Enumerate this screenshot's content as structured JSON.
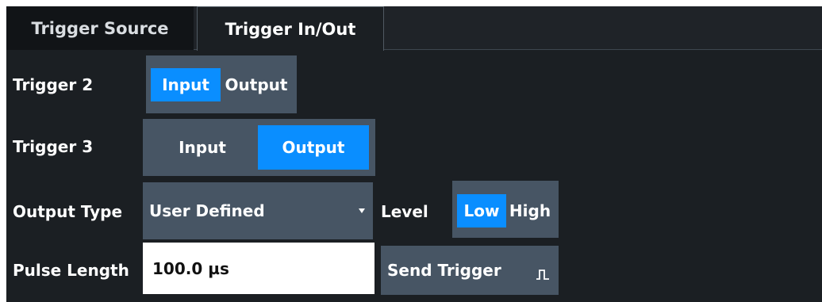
{
  "tabs": [
    {
      "label": "Trigger Source",
      "active": false
    },
    {
      "label": "Trigger In/Out",
      "active": true
    }
  ],
  "trigger2": {
    "label": "Trigger 2",
    "options": [
      "Input",
      "Output"
    ],
    "selected": "Input"
  },
  "trigger3": {
    "label": "Trigger 3",
    "options": [
      "Input",
      "Output"
    ],
    "selected": "Output"
  },
  "output_type": {
    "label": "Output Type",
    "value": "User Defined"
  },
  "level": {
    "label": "Level",
    "options": [
      "Low",
      "High"
    ],
    "selected": "Low"
  },
  "pulse_length": {
    "label": "Pulse Length",
    "value": "100.0 µs"
  },
  "send_trigger": {
    "label": "Send Trigger",
    "icon": "pulse-icon"
  },
  "colors": {
    "accent": "#0a8eff",
    "control_bg": "#475564",
    "panel_bg": "#1b1f23"
  }
}
